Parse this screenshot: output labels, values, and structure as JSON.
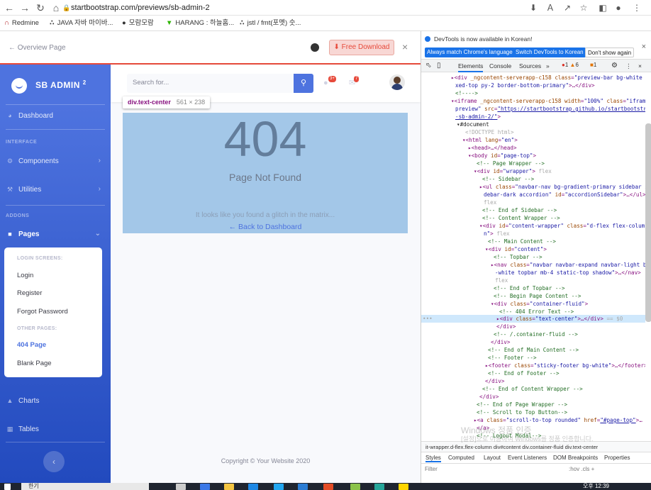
{
  "browser": {
    "url": "startbootstrap.com/previews/sb-admin-2",
    "bookmarks": [
      "Redmine",
      "JAVA 자바 마이바...",
      "모람모람",
      "HARANG : 하늘홈...",
      "jstl / fmt(포멧) 숫..."
    ]
  },
  "preview_bar": {
    "overview": "← Overview Page",
    "download": "Free Download",
    "close": "×"
  },
  "sidebar": {
    "brand": "SB ADMIN",
    "brand_sup": "2",
    "dashboard": "Dashboard",
    "heading_interface": "INTERFACE",
    "components": "Components",
    "utilities": "Utilities",
    "heading_addons": "ADDONS",
    "pages": "Pages",
    "submenu_heading1": "LOGIN SCREENS:",
    "login": "Login",
    "register": "Register",
    "forgot": "Forgot Password",
    "submenu_heading2": "OTHER PAGES:",
    "page404": "404 Page",
    "blank": "Blank Page",
    "charts": "Charts",
    "tables": "Tables"
  },
  "topbar": {
    "search_placeholder": "Search for...",
    "alerts_count": "3+",
    "messages_count": "7"
  },
  "error_page": {
    "code": "404",
    "title": "Page Not Found",
    "message": "It looks like you found a glitch in the matrix...",
    "back_link": "← Back to Dashboard"
  },
  "inspect_tooltip": {
    "selector": "div.text-center",
    "dimensions": "561 × 238"
  },
  "footer": {
    "copyright": "Copyright © Your Website 2020"
  },
  "devtools": {
    "info_text": "DevTools is now available in Korean!",
    "btn_match": "Always match Chrome's language",
    "btn_switch": "Switch DevTools to Korean",
    "btn_dont": "Don't show again",
    "tabs": [
      "Elements",
      "Console",
      "Sources"
    ],
    "more_tabs": "»",
    "errors": "1",
    "warnings": "6",
    "issues": "1",
    "breadcrumb": "it-wrapper.d-flex.flex-column   div#content   div.container-fluid   div.text-center",
    "style_tabs": [
      "Styles",
      "Computed",
      "Layout",
      "Event Listeners",
      "DOM Breakpoints",
      "Properties"
    ],
    "filter_placeholder": "Filter",
    "filter_right": ":hov  .cls  +"
  },
  "watermark": {
    "line1": "Windows 정품 인증",
    "line2": "[설정]으로 이동하여 Windows를 정품 인증합니다."
  },
  "taskbar": {
    "search": "한기",
    "time": "오후 12:39"
  }
}
